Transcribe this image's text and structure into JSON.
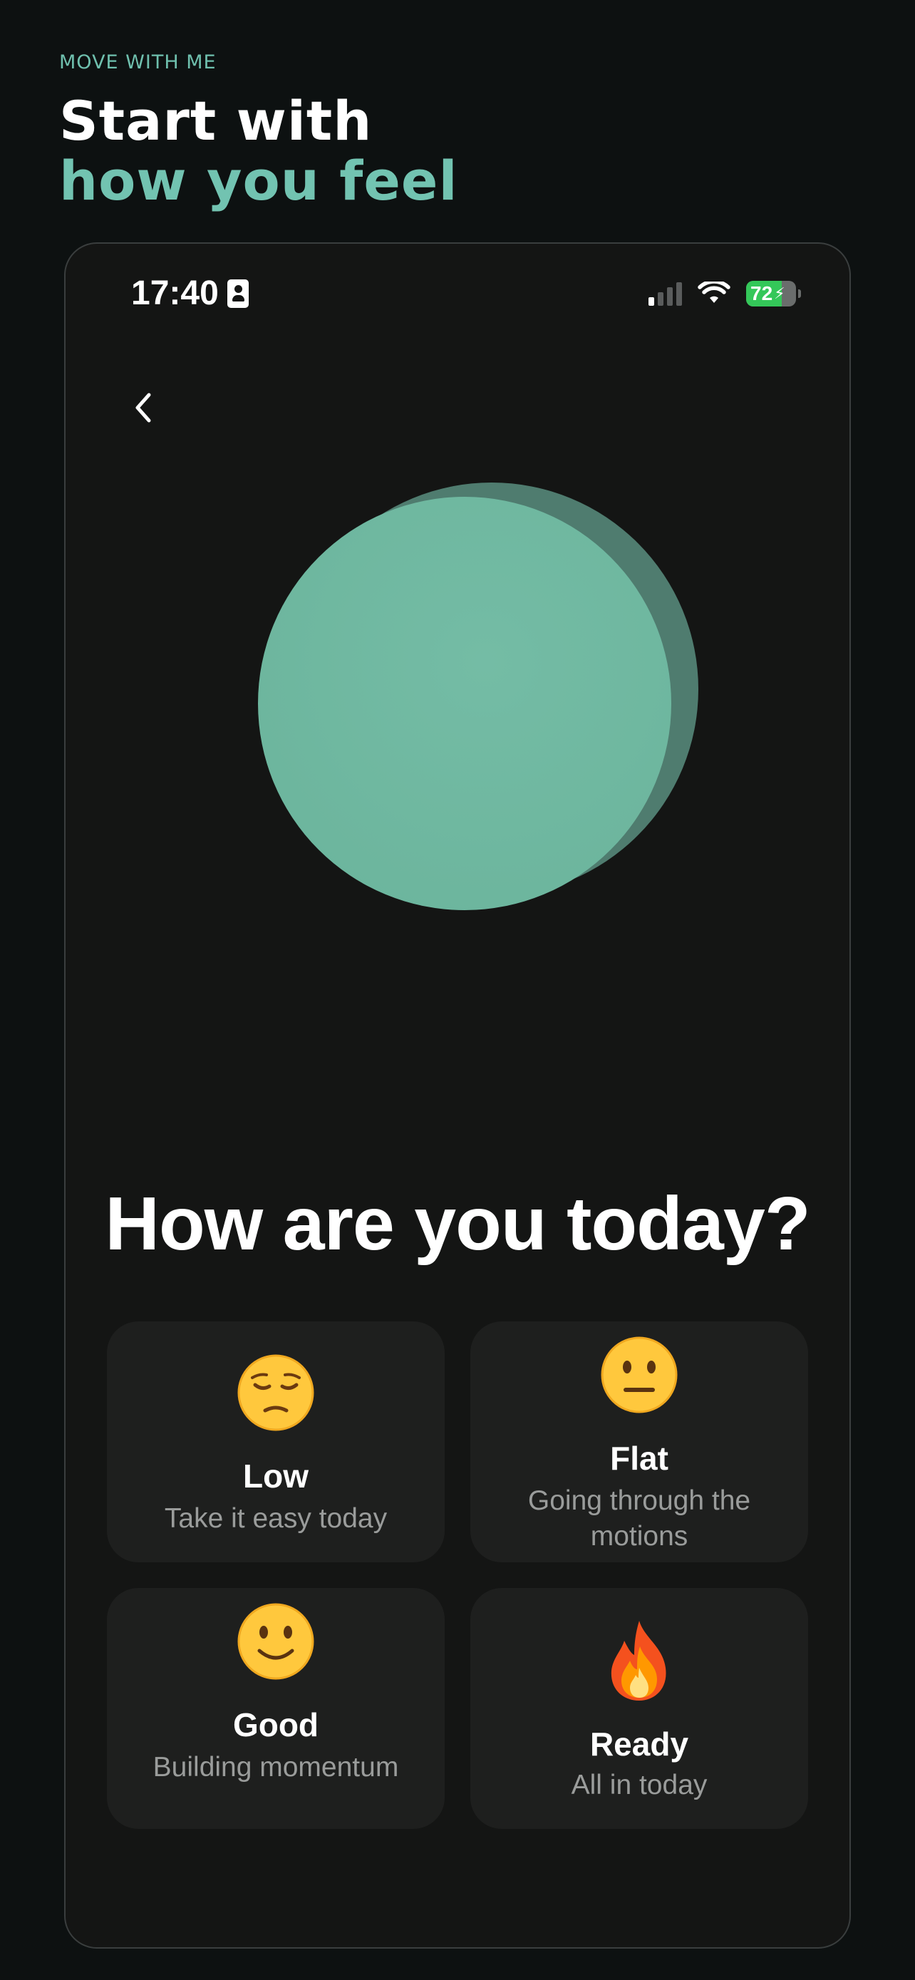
{
  "header": {
    "eyebrow": "MOVE WITH ME",
    "title_line1": "Start with",
    "title_line2": "how you feel"
  },
  "status_bar": {
    "time": "17:40",
    "battery_level": "72",
    "battery_fraction": 0.72,
    "signal_bars_active": 1,
    "signal_bars_total": 4,
    "wifi": true
  },
  "screen": {
    "question": "How are you today?",
    "moods": [
      {
        "emoji": "pensive-face",
        "title": "Low",
        "subtitle": "Take it easy today"
      },
      {
        "emoji": "neutral-face",
        "title": "Flat",
        "subtitle": "Going through the motions"
      },
      {
        "emoji": "slightly-smiling-face",
        "title": "Good",
        "subtitle": "Building momentum"
      },
      {
        "emoji": "fire",
        "title": "Ready",
        "subtitle": "All in today"
      }
    ]
  },
  "colors": {
    "background": "#0d1111",
    "phone_background": "#141514",
    "accent": "#72c3b1",
    "orb": "#6fb8a0",
    "orb_shadow": "#4f7c6f",
    "card": "#1e1f1e",
    "muted_text": "#9a9c9b"
  }
}
